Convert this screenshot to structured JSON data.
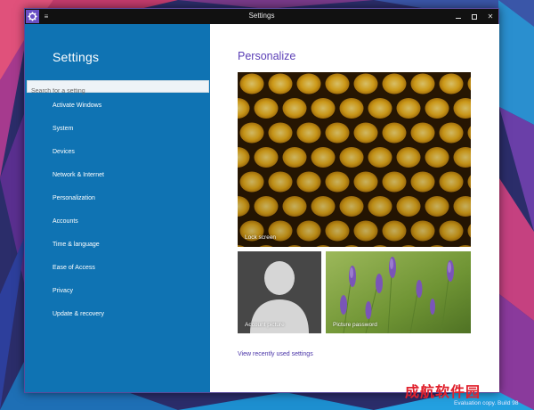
{
  "window": {
    "title": "Settings",
    "close_glyph": "✕"
  },
  "titlebar_icons": {
    "app": "gear-icon",
    "menu": "hamburger-icon",
    "menu_glyph": "≡"
  },
  "sidebar": {
    "title": "Settings",
    "search_placeholder": "Search for a setting",
    "items": [
      "Activate Windows",
      "System",
      "Devices",
      "Network & Internet",
      "Personalization",
      "Accounts",
      "Time & language",
      "Ease of Access",
      "Privacy",
      "Update & recovery"
    ]
  },
  "content": {
    "title": "Personalize",
    "tiles": {
      "lock": "Lock screen",
      "account": "Account picture",
      "picture_password": "Picture password"
    },
    "recent_link": "View recently used settings"
  },
  "overlay": {
    "watermark": "成航软件园",
    "eval": "Evaluation copy. Build 98"
  },
  "colors": {
    "sidebar": "#0f73b3",
    "accent": "#5b3fb6",
    "titlebar": "#111111",
    "watermark": "#e0202c"
  }
}
